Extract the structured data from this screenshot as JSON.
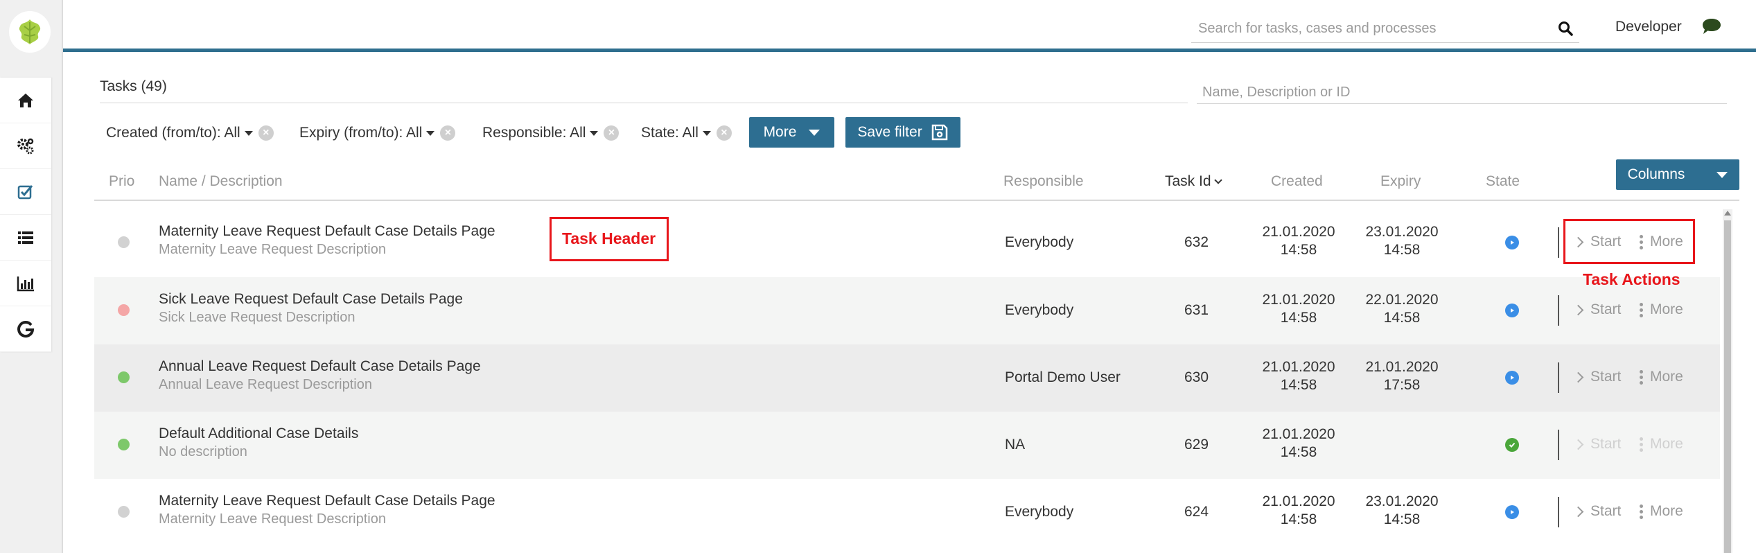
{
  "header": {
    "search_placeholder": "Search for tasks, cases and processes",
    "user_name": "Developer"
  },
  "sidebar": {
    "items": [
      {
        "icon": "home-icon"
      },
      {
        "icon": "gears-icon"
      },
      {
        "icon": "checkbox-icon"
      },
      {
        "icon": "list-icon"
      },
      {
        "icon": "bar-chart-icon"
      },
      {
        "icon": "google-icon"
      }
    ]
  },
  "main": {
    "title": "Tasks (49)",
    "filter_placeholder": "Name, Description or ID",
    "filters": [
      {
        "label": "Created (from/to): All"
      },
      {
        "label": "Expiry (from/to): All"
      },
      {
        "label": "Responsible: All"
      },
      {
        "label": "State: All"
      }
    ],
    "more_button": "More",
    "save_filter_button": "Save filter",
    "columns_button": "Columns"
  },
  "table": {
    "headers": {
      "prio": "Prio",
      "name": "Name / Description",
      "responsible": "Responsible",
      "task_id": "Task Id",
      "created": "Created",
      "expiry": "Expiry",
      "state": "State"
    },
    "rows": [
      {
        "prio_color": "#d2d2d2",
        "name": "Maternity Leave Request Default Case Details Page",
        "desc": "Maternity Leave Request Description",
        "responsible": "Everybody",
        "id": "632",
        "created_date": "21.01.2020",
        "created_time": "14:58",
        "expiry_date": "23.01.2020",
        "expiry_time": "14:58",
        "state": "in-progress"
      },
      {
        "prio_color": "#f4a6a6",
        "name": "Sick Leave Request Default Case Details Page",
        "desc": "Sick Leave Request Description",
        "responsible": "Everybody",
        "id": "631",
        "created_date": "21.01.2020",
        "created_time": "14:58",
        "expiry_date": "22.01.2020",
        "expiry_time": "14:58",
        "state": "in-progress"
      },
      {
        "prio_color": "#7dc86a",
        "name": "Annual Leave Request Default Case Details Page",
        "desc": "Annual Leave Request Description",
        "responsible": "Portal Demo User",
        "id": "630",
        "created_date": "21.01.2020",
        "created_time": "14:58",
        "expiry_date": "21.01.2020",
        "expiry_time": "17:58",
        "state": "in-progress"
      },
      {
        "prio_color": "#7dc86a",
        "name": "Default Additional Case Details",
        "desc": "No description",
        "responsible": "NA",
        "id": "629",
        "created_date": "21.01.2020",
        "created_time": "14:58",
        "expiry_date": "",
        "expiry_time": "",
        "state": "done"
      },
      {
        "prio_color": "#d2d2d2",
        "name": "Maternity Leave Request Default Case Details Page",
        "desc": "Maternity Leave Request Description",
        "responsible": "Everybody",
        "id": "624",
        "created_date": "21.01.2020",
        "created_time": "14:58",
        "expiry_date": "23.01.2020",
        "expiry_time": "14:58",
        "state": "in-progress"
      }
    ],
    "actions": {
      "start": "Start",
      "more": "More"
    }
  },
  "annotations": {
    "task_header": "Task Header",
    "task_actions": "Task Actions"
  },
  "colors": {
    "brand": "#2d6e91",
    "state_in_progress": "#3a8ee6",
    "state_done": "#4aa63a",
    "annotation": "#e8161b"
  }
}
